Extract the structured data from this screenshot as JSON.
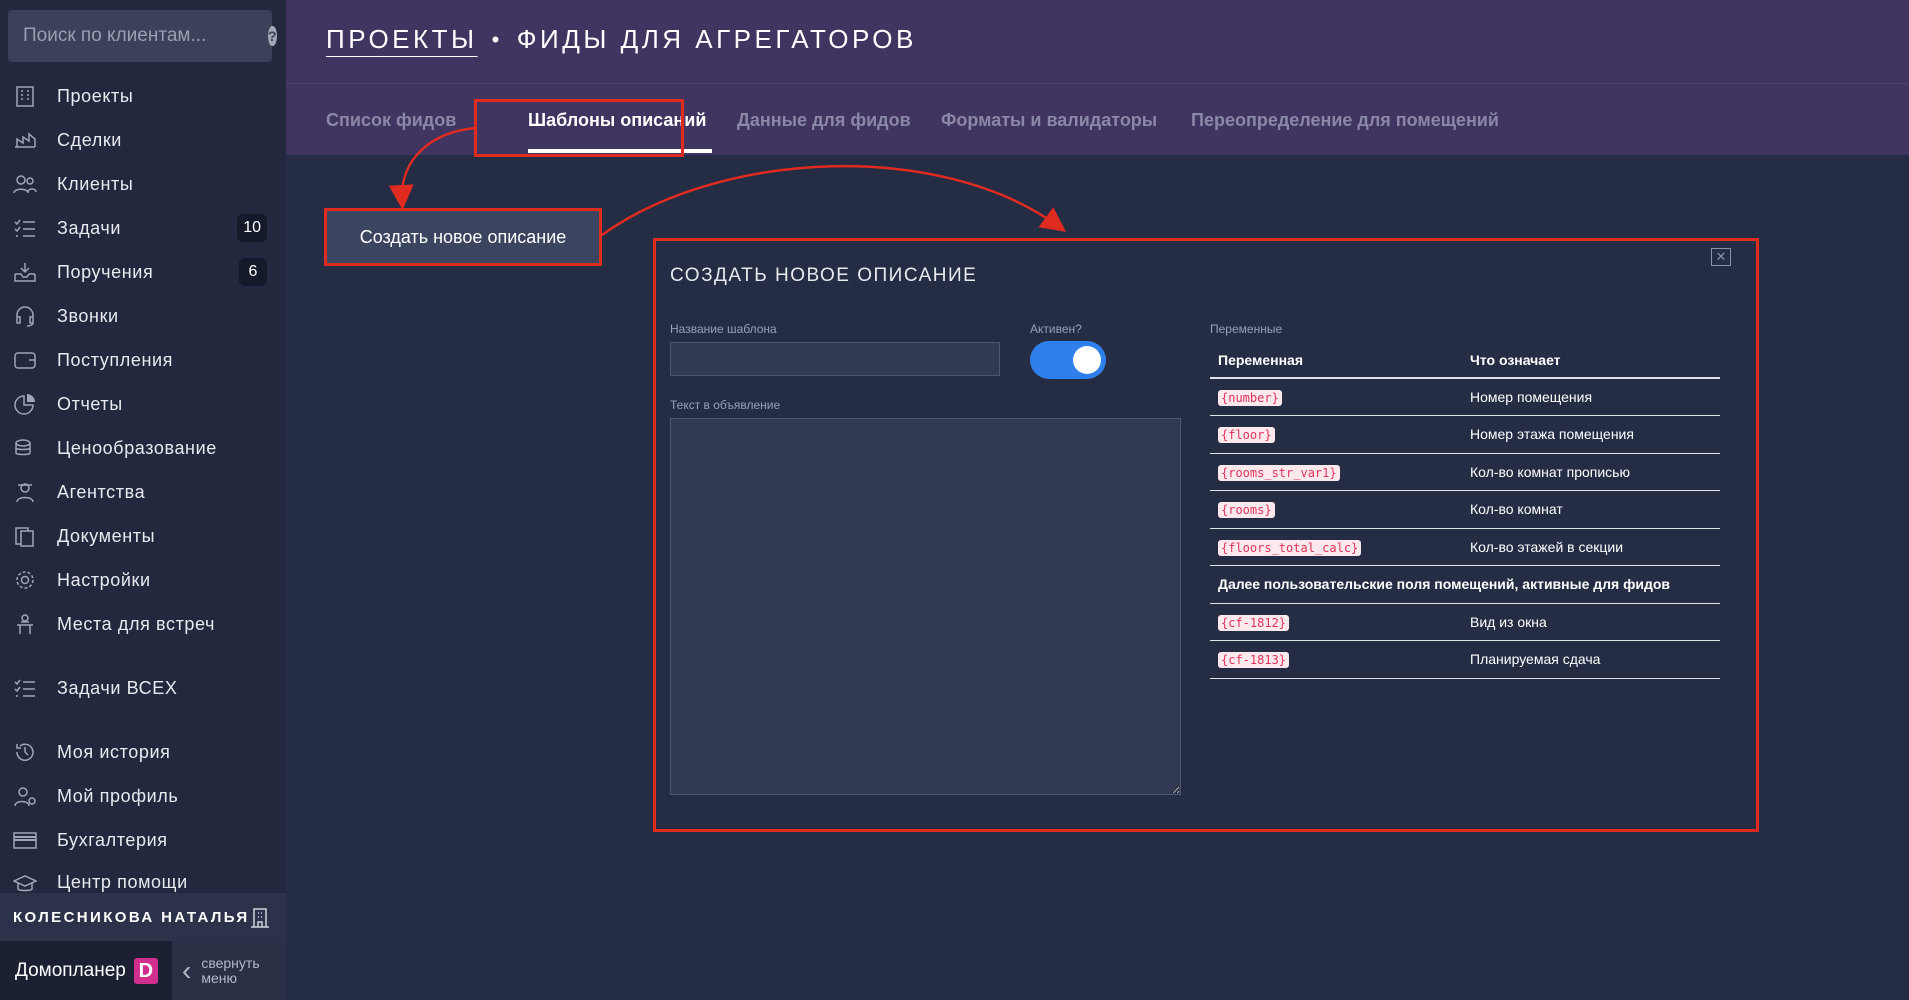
{
  "sidebar": {
    "search_placeholder": "Поиск по клиентам...",
    "items": [
      {
        "label": "Проекты",
        "icon": "building-icon",
        "badge": null
      },
      {
        "label": "Сделки",
        "icon": "deals-icon",
        "badge": null
      },
      {
        "label": "Клиенты",
        "icon": "users-icon",
        "badge": null
      },
      {
        "label": "Задачи",
        "icon": "tasks-icon",
        "badge": "10"
      },
      {
        "label": "Поручения",
        "icon": "inbox-icon",
        "badge": "6"
      },
      {
        "label": "Звонки",
        "icon": "headset-icon",
        "badge": null
      },
      {
        "label": "Поступления",
        "icon": "wallet-icon",
        "badge": null
      },
      {
        "label": "Отчеты",
        "icon": "pie-chart-icon",
        "badge": null
      },
      {
        "label": "Ценообразование",
        "icon": "coins-icon",
        "badge": null
      },
      {
        "label": "Агентства",
        "icon": "agent-icon",
        "badge": null
      },
      {
        "label": "Документы",
        "icon": "documents-icon",
        "badge": null
      },
      {
        "label": "Настройки",
        "icon": "gear-icon",
        "badge": null
      },
      {
        "label": "Места для встреч",
        "icon": "meeting-icon",
        "badge": null
      },
      {
        "label": "Задачи ВСЕХ",
        "icon": "tasks-all-icon",
        "badge": null
      },
      {
        "label": "Моя история",
        "icon": "history-icon",
        "badge": null
      },
      {
        "label": "Мой профиль",
        "icon": "profile-icon",
        "badge": null
      },
      {
        "label": "Бухгалтерия",
        "icon": "card-icon",
        "badge": null
      },
      {
        "label": "Центр помощи",
        "icon": "graduation-icon",
        "badge": null
      }
    ],
    "user_name": "КОЛЕСНИКОВА НАТАЛЬЯ",
    "brand": "Домопланер",
    "brand_logo_letter": "D",
    "collapse_label_1": "свернуть",
    "collapse_label_2": "меню"
  },
  "header": {
    "crumb": "ПРОЕКТЫ",
    "separator": "•",
    "page_title": "ФИДЫ ДЛЯ АГРЕГАТОРОВ",
    "tabs": [
      {
        "label": "Список фидов",
        "active": false
      },
      {
        "label": "Шаблоны описаний",
        "active": true
      },
      {
        "label": "Данные для фидов",
        "active": false
      },
      {
        "label": "Форматы и валидаторы",
        "active": false
      },
      {
        "label": "Переопределение для помещений",
        "active": false
      }
    ]
  },
  "main": {
    "create_button": "Создать новое описание"
  },
  "modal": {
    "title": "СОЗДАТЬ НОВОЕ ОПИСАНИЕ",
    "close_glyph": "✕",
    "template_name_label": "Название шаблона",
    "template_name_value": "",
    "active_label": "Активен?",
    "active": true,
    "ad_text_label": "Текст в объявление",
    "ad_text_value": "",
    "variables_label": "Переменные",
    "vars_header": {
      "var": "Переменная",
      "meaning": "Что означает"
    },
    "vars": [
      {
        "var": "{number}",
        "meaning": "Номер помещения"
      },
      {
        "var": "{floor}",
        "meaning": "Номер этажа помещения"
      },
      {
        "var": "{rooms_str_var1}",
        "meaning": "Кол-во комнат прописью"
      },
      {
        "var": "{rooms}",
        "meaning": "Кол-во комнат"
      },
      {
        "var": "{floors_total_calc}",
        "meaning": "Кол-во этажей в секции"
      }
    ],
    "custom_fields_note": "Далее пользовательские поля помещений, активные для фидов",
    "custom_vars": [
      {
        "var": "{cf-1812}",
        "meaning": "Вид из окна"
      },
      {
        "var": "{cf-1813}",
        "meaning": "Планируемая сдача"
      }
    ]
  },
  "colors": {
    "annotation_red": "#e02b20",
    "toggle_blue": "#2f80ed",
    "header_purple": "#3f3560",
    "brand_pink": "#d12f8e"
  }
}
